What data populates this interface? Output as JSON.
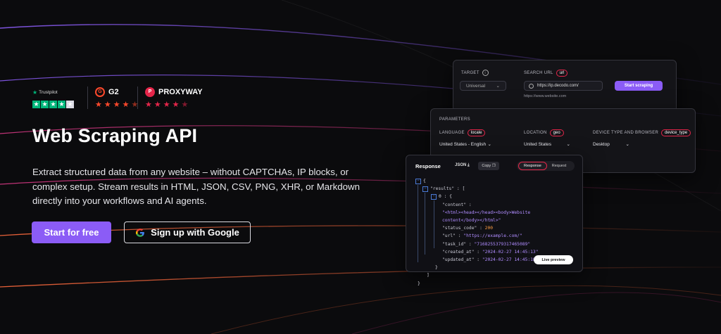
{
  "colors": {
    "accent": "#8b5cf6",
    "background": "#0b0b0d",
    "trustpilot_green": "#00b67a",
    "g2_red": "#ff492c",
    "proxyway_red": "#e5264a"
  },
  "badges": {
    "trustpilot": {
      "label": "Trustpilot",
      "rating": 4
    },
    "g2": {
      "label": "G2",
      "rating": 4.5
    },
    "proxyway": {
      "label": "PROXYWAY",
      "rating": 4.5
    }
  },
  "hero": {
    "title": "Web Scraping API",
    "description": "Extract structured data from any website – without CAPTCHAs, IP blocks, or complex setup. Stream results in HTML, JSON, CSV, PNG, XHR, or Markdown directly into your workflows and AI agents.",
    "cta_primary": "Start for free",
    "cta_google": "Sign up with Google"
  },
  "target_panel": {
    "target_label": "TARGET",
    "target_value": "Universal",
    "search_url_label": "SEARCH URL",
    "search_url_tag": "url",
    "url_value": "https://ip.decodo.com/",
    "url_hint": "https://www.website.com",
    "start_button": "Start scraping"
  },
  "params_panel": {
    "title": "PARAMETERS",
    "language_label": "LANGUAGE",
    "language_tag": "locale",
    "language_value": "United States - English",
    "location_label": "LOCATION",
    "location_tag": "geo",
    "location_value": "United States",
    "device_label": "DEVICE TYPE AND BROWSER",
    "device_tag": "device_type",
    "device_value": "Desktop"
  },
  "response_panel": {
    "title": "Response",
    "format": "JSON",
    "copy_label": "Copy",
    "tab_response": "Response",
    "tab_request": "Request",
    "live_preview": "Live preview",
    "json": {
      "results_key": "\"results\"",
      "index": "0",
      "content_key": "\"content\"",
      "content_value_1": "\"<html><head></head><body>Website",
      "content_value_2": "content</body></html>\"",
      "status_code_key": "\"status_code\"",
      "status_code": "200",
      "url_key": "\"url\"",
      "url": "\"https://example.com/\"",
      "task_id_key": "\"task_id\"",
      "task_id": "\"7168255379317465089\"",
      "created_at_key": "\"created_at\"",
      "created_at": "\"2024-02-27 14:45:13\"",
      "updated_at_key": "\"updated_at\"",
      "updated_at": "\"2024-02-27 14:45:18\""
    }
  }
}
